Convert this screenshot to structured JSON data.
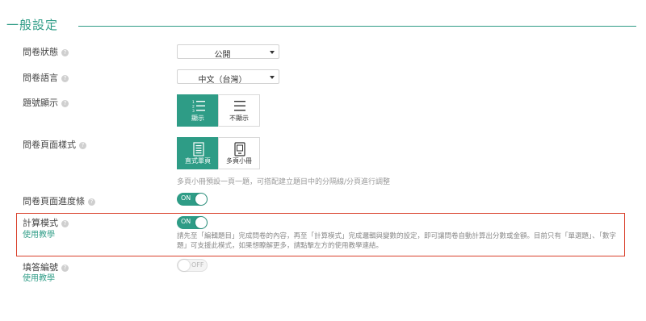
{
  "section": {
    "title": "一般設定"
  },
  "fields": {
    "status": {
      "label": "問卷狀態",
      "value": "公開"
    },
    "language": {
      "label": "問卷語言",
      "value": "中文（台灣）"
    },
    "numbering": {
      "label": "題號顯示",
      "options": [
        {
          "label": "顯示",
          "icon": "numbered-list-icon",
          "selected": true
        },
        {
          "label": "不顯示",
          "icon": "plain-list-icon",
          "selected": false
        }
      ]
    },
    "page_style": {
      "label": "問卷頁面樣式",
      "options": [
        {
          "label": "直式單頁",
          "icon": "single-page-icon",
          "selected": true
        },
        {
          "label": "多頁小冊",
          "icon": "booklet-icon",
          "selected": false
        }
      ],
      "note": "多頁小冊預設一頁一題，可搭配建立題目中的分隔線/分頁進行調整"
    },
    "progress_bar": {
      "label": "問卷頁面進度條",
      "toggle": "ON",
      "on": true
    },
    "calc_mode": {
      "label": "計算模式",
      "link": "使用教學",
      "toggle": "ON",
      "on": true,
      "description": "請先至「編輯題目」完成問卷的內容，再至「計算模式」完成邏輯與變數的設定，即可讓問卷自動計算出分數或金額。目前只有「單選題」、「數字題」可支援此模式，如果想瞭解更多，請點擊左方的使用教學連結。"
    },
    "response_number": {
      "label": "填答編號",
      "link": "使用教學",
      "toggle": "OFF",
      "on": false
    }
  },
  "colors": {
    "accent": "#2e9c86",
    "highlight_border": "#d9402b"
  }
}
